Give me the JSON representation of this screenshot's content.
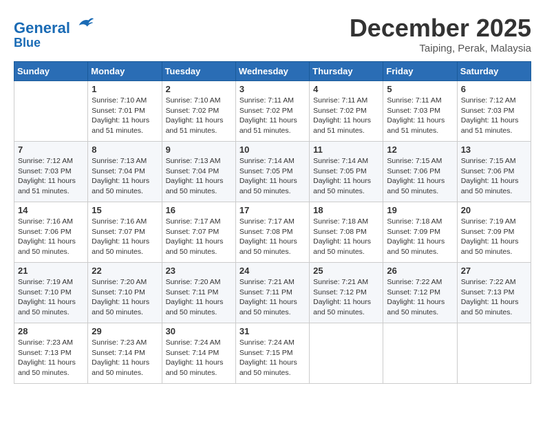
{
  "logo": {
    "line1": "General",
    "line2": "Blue"
  },
  "title": "December 2025",
  "location": "Taiping, Perak, Malaysia",
  "headers": [
    "Sunday",
    "Monday",
    "Tuesday",
    "Wednesday",
    "Thursday",
    "Friday",
    "Saturday"
  ],
  "weeks": [
    [
      {
        "day": "",
        "sunrise": "",
        "sunset": "",
        "daylight": ""
      },
      {
        "day": "1",
        "sunrise": "Sunrise: 7:10 AM",
        "sunset": "Sunset: 7:01 PM",
        "daylight": "Daylight: 11 hours and 51 minutes."
      },
      {
        "day": "2",
        "sunrise": "Sunrise: 7:10 AM",
        "sunset": "Sunset: 7:02 PM",
        "daylight": "Daylight: 11 hours and 51 minutes."
      },
      {
        "day": "3",
        "sunrise": "Sunrise: 7:11 AM",
        "sunset": "Sunset: 7:02 PM",
        "daylight": "Daylight: 11 hours and 51 minutes."
      },
      {
        "day": "4",
        "sunrise": "Sunrise: 7:11 AM",
        "sunset": "Sunset: 7:02 PM",
        "daylight": "Daylight: 11 hours and 51 minutes."
      },
      {
        "day": "5",
        "sunrise": "Sunrise: 7:11 AM",
        "sunset": "Sunset: 7:03 PM",
        "daylight": "Daylight: 11 hours and 51 minutes."
      },
      {
        "day": "6",
        "sunrise": "Sunrise: 7:12 AM",
        "sunset": "Sunset: 7:03 PM",
        "daylight": "Daylight: 11 hours and 51 minutes."
      }
    ],
    [
      {
        "day": "7",
        "sunrise": "Sunrise: 7:12 AM",
        "sunset": "Sunset: 7:03 PM",
        "daylight": "Daylight: 11 hours and 51 minutes."
      },
      {
        "day": "8",
        "sunrise": "Sunrise: 7:13 AM",
        "sunset": "Sunset: 7:04 PM",
        "daylight": "Daylight: 11 hours and 50 minutes."
      },
      {
        "day": "9",
        "sunrise": "Sunrise: 7:13 AM",
        "sunset": "Sunset: 7:04 PM",
        "daylight": "Daylight: 11 hours and 50 minutes."
      },
      {
        "day": "10",
        "sunrise": "Sunrise: 7:14 AM",
        "sunset": "Sunset: 7:05 PM",
        "daylight": "Daylight: 11 hours and 50 minutes."
      },
      {
        "day": "11",
        "sunrise": "Sunrise: 7:14 AM",
        "sunset": "Sunset: 7:05 PM",
        "daylight": "Daylight: 11 hours and 50 minutes."
      },
      {
        "day": "12",
        "sunrise": "Sunrise: 7:15 AM",
        "sunset": "Sunset: 7:06 PM",
        "daylight": "Daylight: 11 hours and 50 minutes."
      },
      {
        "day": "13",
        "sunrise": "Sunrise: 7:15 AM",
        "sunset": "Sunset: 7:06 PM",
        "daylight": "Daylight: 11 hours and 50 minutes."
      }
    ],
    [
      {
        "day": "14",
        "sunrise": "Sunrise: 7:16 AM",
        "sunset": "Sunset: 7:06 PM",
        "daylight": "Daylight: 11 hours and 50 minutes."
      },
      {
        "day": "15",
        "sunrise": "Sunrise: 7:16 AM",
        "sunset": "Sunset: 7:07 PM",
        "daylight": "Daylight: 11 hours and 50 minutes."
      },
      {
        "day": "16",
        "sunrise": "Sunrise: 7:17 AM",
        "sunset": "Sunset: 7:07 PM",
        "daylight": "Daylight: 11 hours and 50 minutes."
      },
      {
        "day": "17",
        "sunrise": "Sunrise: 7:17 AM",
        "sunset": "Sunset: 7:08 PM",
        "daylight": "Daylight: 11 hours and 50 minutes."
      },
      {
        "day": "18",
        "sunrise": "Sunrise: 7:18 AM",
        "sunset": "Sunset: 7:08 PM",
        "daylight": "Daylight: 11 hours and 50 minutes."
      },
      {
        "day": "19",
        "sunrise": "Sunrise: 7:18 AM",
        "sunset": "Sunset: 7:09 PM",
        "daylight": "Daylight: 11 hours and 50 minutes."
      },
      {
        "day": "20",
        "sunrise": "Sunrise: 7:19 AM",
        "sunset": "Sunset: 7:09 PM",
        "daylight": "Daylight: 11 hours and 50 minutes."
      }
    ],
    [
      {
        "day": "21",
        "sunrise": "Sunrise: 7:19 AM",
        "sunset": "Sunset: 7:10 PM",
        "daylight": "Daylight: 11 hours and 50 minutes."
      },
      {
        "day": "22",
        "sunrise": "Sunrise: 7:20 AM",
        "sunset": "Sunset: 7:10 PM",
        "daylight": "Daylight: 11 hours and 50 minutes."
      },
      {
        "day": "23",
        "sunrise": "Sunrise: 7:20 AM",
        "sunset": "Sunset: 7:11 PM",
        "daylight": "Daylight: 11 hours and 50 minutes."
      },
      {
        "day": "24",
        "sunrise": "Sunrise: 7:21 AM",
        "sunset": "Sunset: 7:11 PM",
        "daylight": "Daylight: 11 hours and 50 minutes."
      },
      {
        "day": "25",
        "sunrise": "Sunrise: 7:21 AM",
        "sunset": "Sunset: 7:12 PM",
        "daylight": "Daylight: 11 hours and 50 minutes."
      },
      {
        "day": "26",
        "sunrise": "Sunrise: 7:22 AM",
        "sunset": "Sunset: 7:12 PM",
        "daylight": "Daylight: 11 hours and 50 minutes."
      },
      {
        "day": "27",
        "sunrise": "Sunrise: 7:22 AM",
        "sunset": "Sunset: 7:13 PM",
        "daylight": "Daylight: 11 hours and 50 minutes."
      }
    ],
    [
      {
        "day": "28",
        "sunrise": "Sunrise: 7:23 AM",
        "sunset": "Sunset: 7:13 PM",
        "daylight": "Daylight: 11 hours and 50 minutes."
      },
      {
        "day": "29",
        "sunrise": "Sunrise: 7:23 AM",
        "sunset": "Sunset: 7:14 PM",
        "daylight": "Daylight: 11 hours and 50 minutes."
      },
      {
        "day": "30",
        "sunrise": "Sunrise: 7:24 AM",
        "sunset": "Sunset: 7:14 PM",
        "daylight": "Daylight: 11 hours and 50 minutes."
      },
      {
        "day": "31",
        "sunrise": "Sunrise: 7:24 AM",
        "sunset": "Sunset: 7:15 PM",
        "daylight": "Daylight: 11 hours and 50 minutes."
      },
      {
        "day": "",
        "sunrise": "",
        "sunset": "",
        "daylight": ""
      },
      {
        "day": "",
        "sunrise": "",
        "sunset": "",
        "daylight": ""
      },
      {
        "day": "",
        "sunrise": "",
        "sunset": "",
        "daylight": ""
      }
    ]
  ]
}
